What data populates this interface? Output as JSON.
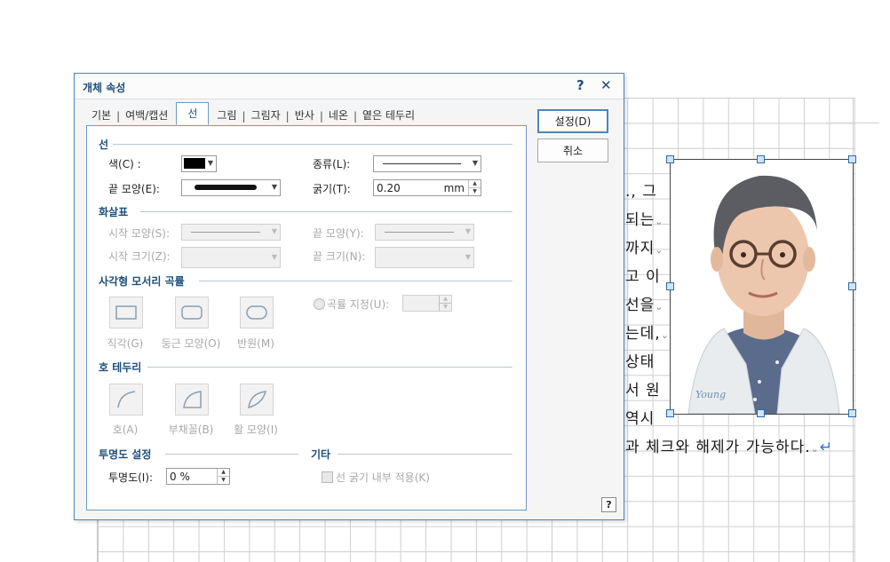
{
  "dialog": {
    "title": "개체 속성",
    "help_symbol": "?",
    "close_symbol": "✕",
    "tabs": [
      "기본",
      "여백/캡션",
      "선",
      "그림",
      "그림자",
      "반사",
      "네온",
      "옅은 테두리"
    ],
    "active_tab": "선",
    "buttons": {
      "ok": "설정(D)",
      "cancel": "취소",
      "help": "?"
    }
  },
  "line_section": {
    "title": "선",
    "color_label": "색(C) :",
    "color_value": "#000000",
    "type_label": "종류(L):",
    "end_shape_label": "끝 모양(E):",
    "thickness_label": "굵기(T):",
    "thickness_value": "0.20",
    "thickness_unit": "mm"
  },
  "arrow_section": {
    "title": "화살표",
    "start_shape_label": "시작 모양(S):",
    "end_shape_label": "끝 모양(Y):",
    "start_size_label": "시작 크기(Z):",
    "end_size_label": "끝 크기(N):"
  },
  "corner_section": {
    "title": "사각형 모서리 곡률",
    "options": [
      "직각(G)",
      "둥근 모양(O)",
      "반원(M)"
    ],
    "curvature_label": "곡률 지정(U):"
  },
  "arc_section": {
    "title": "호 테두리",
    "options": [
      "호(A)",
      "부채꼴(B)",
      "활 모양(I)"
    ]
  },
  "transparency_section": {
    "title": "투명도 설정",
    "label": "투명도(I):",
    "value": "0 %"
  },
  "other_section": {
    "title": "기타",
    "apply_inside_label": "선 굵기 내부 적용(K)"
  },
  "document": {
    "lines": [
      "., 그",
      "되는",
      "까지",
      "고 이",
      "선을",
      "는데,",
      "상태",
      "서 원",
      "역시"
    ],
    "last_line": "과 체크와 해제가 가능하다.",
    "photo_signature": "Young"
  }
}
